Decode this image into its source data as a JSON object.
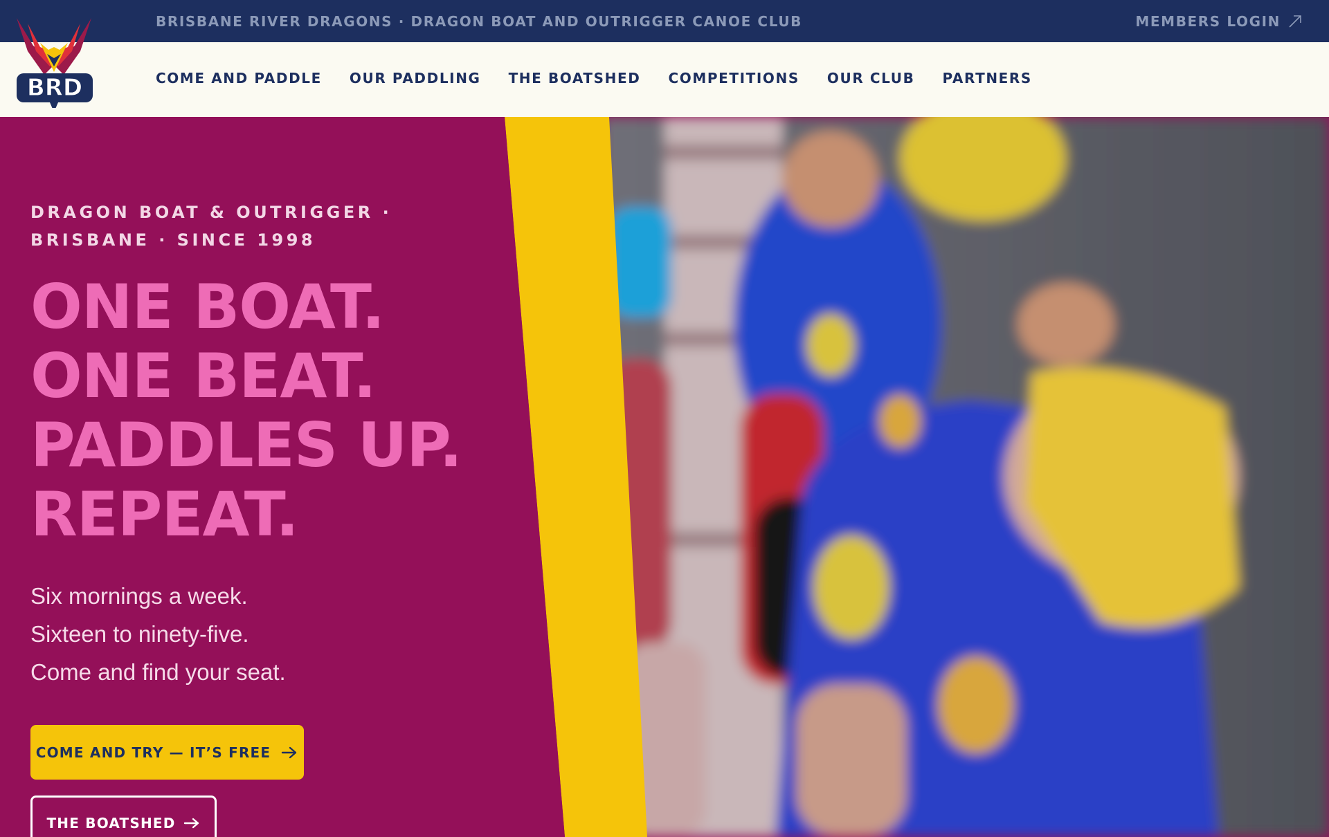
{
  "topbar": {
    "club_line": "BRISBANE RIVER DRAGONS · DRAGON BOAT AND OUTRIGGER CANOE CLUB",
    "members_login": "MEMBERS LOGIN",
    "members_login_icon": "external-arrow-icon"
  },
  "logo": {
    "text": "BRD",
    "icon": "dragon-wings-icon"
  },
  "nav": {
    "items": [
      {
        "label": "COME AND PADDLE"
      },
      {
        "label": "OUR PADDLING"
      },
      {
        "label": "THE BOATSHED"
      },
      {
        "label": "COMPETITIONS"
      },
      {
        "label": "OUR CLUB"
      },
      {
        "label": "PARTNERS"
      }
    ]
  },
  "hero": {
    "eyebrow_line1": "DRAGON BOAT & OUTRIGGER ·",
    "eyebrow_line2": "BRISBANE · SINCE 1998",
    "headline": [
      "ONE BOAT.",
      "ONE BEAT.",
      "PADDLES UP.",
      "REPEAT."
    ],
    "subcopy": [
      "Six mornings a week.",
      "Sixteen to ninety-five.",
      "Come and find your seat."
    ],
    "cta_primary": "COME AND TRY — IT’S FREE",
    "cta_secondary": "THE BOATSHED"
  },
  "colors": {
    "navy": "#1d2f5f",
    "magenta": "#941059",
    "pink": "#ee6cb6",
    "yellow": "#f5c40a",
    "cream": "#fbfaf2"
  }
}
